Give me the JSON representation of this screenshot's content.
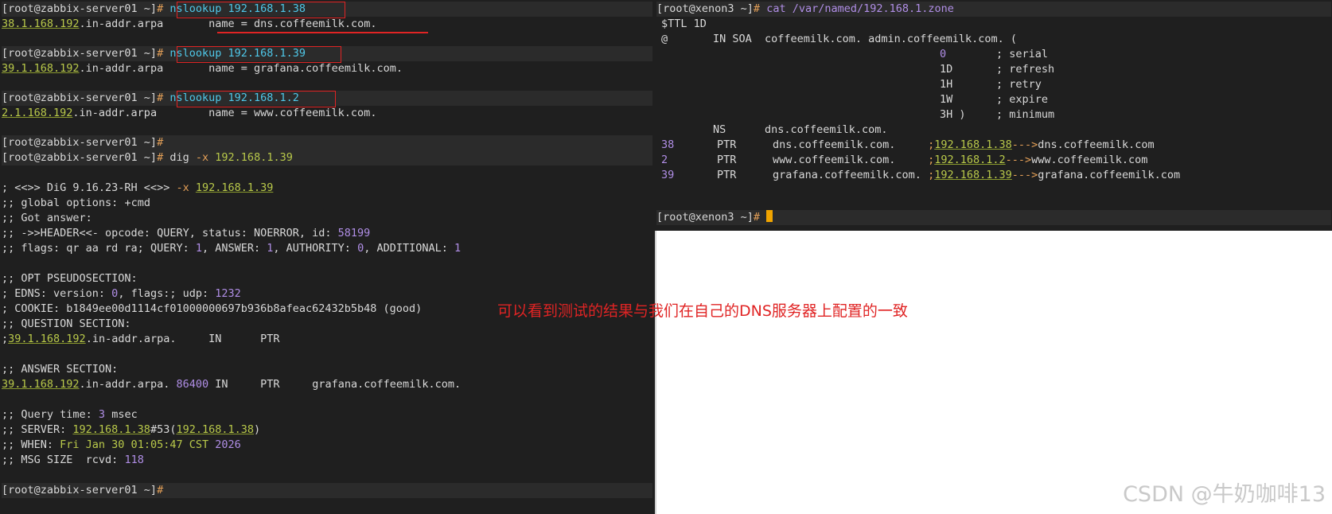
{
  "left_terminal": {
    "prompt": "[root@zabbix-server01 ~]",
    "lines": [
      {
        "cmd": "nslookup 192.168.1.38"
      },
      {
        "addr": "38.1.168.192",
        "suffix": ".in-addr.arpa",
        "name_label": "name",
        "eq": " = ",
        "value": "dns.coffeemilk.com."
      },
      {
        "cmd": "nslookup 192.168.1.39"
      },
      {
        "addr": "39.1.168.192",
        "suffix": ".in-addr.arpa",
        "name_label": "name",
        "eq": " = ",
        "value": "grafana.coffeemilk.com."
      },
      {
        "cmd": "nslookup 192.168.1.2"
      },
      {
        "addr": "2.1.168.192",
        "suffix": ".in-addr.arpa",
        "name_label": "name",
        "eq": " = ",
        "value": "www.coffeemilk.com."
      },
      {
        "cmd": ""
      },
      {
        "cmd_dig": "dig",
        "cmd_flag": "-x",
        "cmd_arg": "192.168.1.39"
      }
    ],
    "dig": {
      "banner_a": "; <<>> DiG 9.16.23-RH <<>> ",
      "banner_flag": "-x",
      "banner_ip": "192.168.1.39",
      "global_a": ";; global options: ",
      "global_b": "+cmd",
      "got": ";; Got answer:",
      "header_a": ";; ->>HEADER<<- opcode: ",
      "header_b": "QUERY, status: ",
      "header_c": "NOERROR, id: ",
      "header_id": "58199",
      "flags_a": ";; flags: ",
      "flags_b": "qr aa rd ra; QUERY: ",
      "flags_q": "1",
      "flags_c": ", ANSWER: ",
      "flags_an": "1",
      "flags_d": ", AUTHORITY: ",
      "flags_au": "0",
      "flags_e": ", ADDITIONAL: ",
      "flags_ad": "1",
      "opt": ";; OPT PSEUDOSECTION:",
      "edns_a": "; EDNS: version: ",
      "edns_v": "0",
      "edns_b": ", flags:; udp: ",
      "edns_udp": "1232",
      "cookie": "; COOKIE: b1849ee00d1114cf01000000697b936b8afeac62432b5b48 (good)",
      "question": ";; QUESTION SECTION:",
      "q_addr": "39.1.168.192",
      "q_suffix": ".in-addr.arpa.",
      "q_in": "IN",
      "q_ptr": "PTR",
      "answer": ";; ANSWER SECTION:",
      "a_addr": "39.1.168.192",
      "a_suffix": ".in-addr.arpa.",
      "a_ttl": "86400",
      "a_in": "IN",
      "a_ptr": "PTR",
      "a_name": "grafana.coffeemilk.com.",
      "qt_a": ";; Query time: ",
      "qt_v": "3",
      "qt_b": " msec",
      "srv_a": ";; SERVER: ",
      "srv_ip": "192.168.1.38",
      "srv_port": "#53(",
      "srv_ip2": "192.168.1.38",
      "srv_close": ")",
      "when_a": ";; WHEN: ",
      "when_b": "Fri Jan 30 01:05:47 CST ",
      "when_year": "2026",
      "msg_a": ";; MSG SIZE  rcvd: ",
      "msg_v": "118"
    },
    "final_prompt": "[root@zabbix-server01 ~]"
  },
  "right_terminal": {
    "prompt": "[root@xenon3 ~]",
    "cmd": "cat /var/named/192.168.1.zone",
    "ttl": "$TTL 1D",
    "soa": "@       IN SOA  coffeemilk.com. admin.coffeemilk.com. (",
    "soa_lines": [
      {
        "num": "0",
        "comment": "; serial"
      },
      {
        "num": "1D",
        "comment": "; refresh"
      },
      {
        "num": "1H",
        "comment": "; retry"
      },
      {
        "num": "1W",
        "comment": "; expire"
      },
      {
        "num": "3H )",
        "comment": "; minimum"
      }
    ],
    "ns": "        NS      dns.coffeemilk.com.",
    "ptr_rows": [
      {
        "num": "38",
        "type": "PTR",
        "host": "dns.coffeemilk.com.     ",
        "ip": "192.168.1.38",
        "arrow": "--->",
        "dest": "dns.coffeemilk.com"
      },
      {
        "num": "2",
        "type": "PTR",
        "host": "www.coffeemilk.com.     ",
        "ip": "192.168.1.2",
        "arrow": "--->",
        "dest": "www.coffeemilk.com"
      },
      {
        "num": "39",
        "type": "PTR",
        "host": "grafana.coffeemilk.com. ",
        "ip": "192.168.1.39",
        "arrow": "--->",
        "dest": "grafana.coffeemilk.com"
      }
    ],
    "final_prompt": "[root@xenon3 ~]"
  },
  "annotation": "可以看到测试的结果与我们在自己的DNS服务器上配置的一致",
  "watermark": "CSDN @牛奶咖啡13",
  "colors": {
    "terminal_bg": "#1f1f1f",
    "highlight_box": "#e02424",
    "ip_green": "#b9c94a",
    "cmd_cyan": "#4fc7e8",
    "number_purple": "#b08ee6",
    "cursor_orange": "#f0a400"
  }
}
